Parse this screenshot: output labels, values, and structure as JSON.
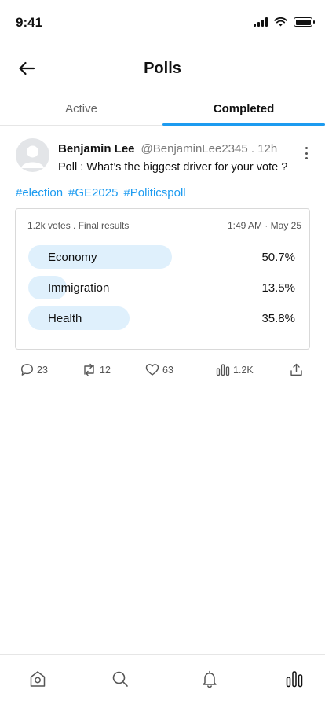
{
  "status_bar": {
    "time": "9:41"
  },
  "header": {
    "title": "Polls"
  },
  "tabs": [
    {
      "label": "Active",
      "active": false
    },
    {
      "label": "Completed",
      "active": true
    }
  ],
  "post": {
    "author_name": "Benjamin Lee",
    "author_handle": "@BenjaminLee2345 . 12h",
    "text": "Poll : What’s the biggest driver for your vote ?",
    "hashtags": [
      "#election",
      "#GE2025",
      "#Politicspoll"
    ],
    "poll": {
      "meta": "1.2k votes . Final results",
      "date": "1:49 AM · May 25",
      "options": [
        {
          "label": "Economy",
          "percent": "50.7%",
          "fraction": 0.507
        },
        {
          "label": "Immigration",
          "percent": "13.5%",
          "fraction": 0.135
        },
        {
          "label": "Health",
          "percent": "35.8%",
          "fraction": 0.358
        }
      ]
    },
    "actions": {
      "replies": "23",
      "reposts": "12",
      "likes": "63",
      "views": "1.2K"
    }
  },
  "colors": {
    "accent": "#1d9bf0",
    "poll_bar": "#dff0fc"
  },
  "icons": {
    "back": "arrow-left-icon",
    "more": "vertical-ellipsis-icon",
    "reply": "speech-bubble-icon",
    "repost": "repost-arrows-icon",
    "like": "heart-icon",
    "views": "bar-chart-icon",
    "share": "share-upload-icon",
    "nav": [
      "home-icon",
      "search-icon",
      "bell-icon",
      "polls-chart-icon"
    ]
  }
}
